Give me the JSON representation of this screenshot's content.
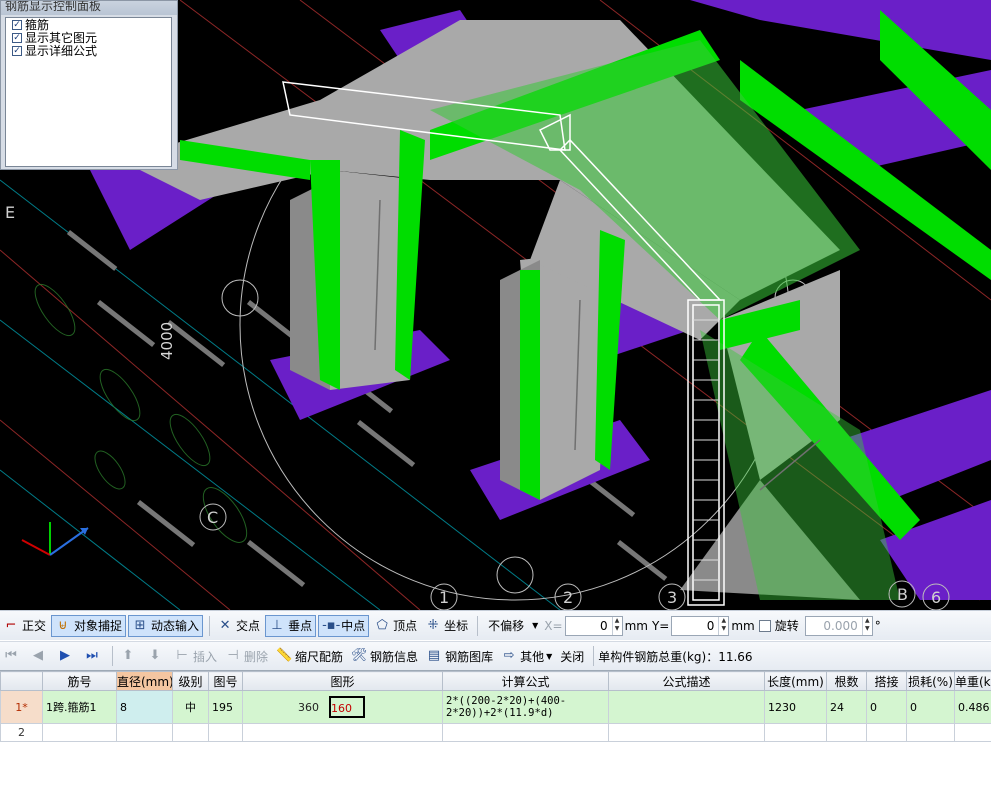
{
  "panel": {
    "title": "钢筋显示控制面板",
    "options": [
      {
        "label": "箍筋",
        "checked": true
      },
      {
        "label": "显示其它图元",
        "checked": true
      },
      {
        "label": "显示详细公式",
        "checked": true
      }
    ]
  },
  "viewport": {
    "axis_labels": [
      "E",
      "C",
      "1",
      "2",
      "3",
      "B",
      "6"
    ],
    "dimension_text": "4000",
    "colors": {
      "background": "#000000",
      "column_green": "#00e000",
      "beam_purple": "#6a1fc8",
      "concrete_gray": "#a8a8a8",
      "stirrup": "#ffffff"
    }
  },
  "toolbar1": {
    "ortho": "正交",
    "snap": "对象捕捉",
    "dynamic_input": "动态输入",
    "intersection": "交点",
    "perpendicular": "垂点",
    "midpoint": "中点",
    "vertex": "顶点",
    "coordinate": "坐标",
    "offset_mode": "不偏移",
    "x_label": "X=",
    "x_value": "0",
    "x_unit": "mm",
    "y_label": "Y=",
    "y_value": "0",
    "y_unit": "mm",
    "rotate_label": "旋转",
    "rotate_value": "0.000",
    "rotate_unit": "°"
  },
  "toolbar2": {
    "insert": "插入",
    "delete": "删除",
    "scale_rebar": "缩尺配筋",
    "rebar_info": "钢筋信息",
    "rebar_library": "钢筋图库",
    "other": "其他",
    "close": "关闭",
    "total_weight": "单构件钢筋总重(kg)：11.66"
  },
  "grid": {
    "headers": [
      "",
      "筋号",
      "直径(mm)",
      "级别",
      "图号",
      "图形",
      "计算公式",
      "公式描述",
      "长度(mm)",
      "根数",
      "搭接",
      "损耗(%)",
      "单重(kg)"
    ],
    "rows": [
      {
        "row_id": "1*",
        "bar_no": "1跨.箍筋1",
        "diameter": "8",
        "grade": "中",
        "shape_no": "195",
        "shape_dim1": "360",
        "shape_dim2": "160",
        "formula": "2*((200-2*20)+(400-2*20))+2*(11.9*d)",
        "formula_desc": "",
        "length": "1230",
        "count": "24",
        "lap": "0",
        "loss": "0",
        "unit_weight": "0.486"
      },
      {
        "row_id": "2"
      }
    ]
  }
}
